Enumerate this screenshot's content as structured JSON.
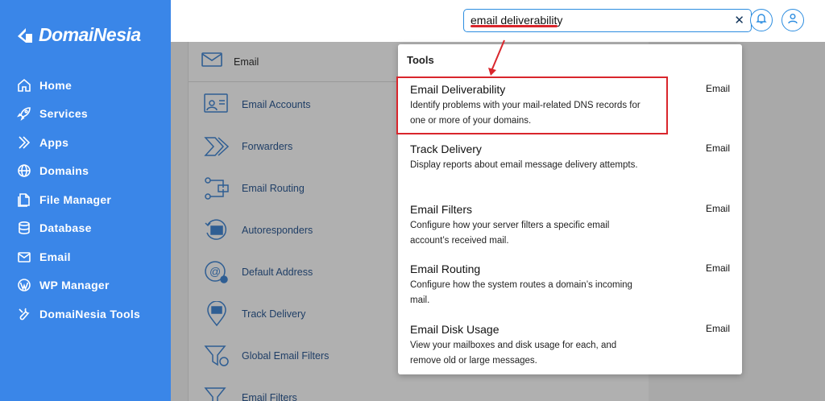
{
  "brand": {
    "name": "DomaiNesia"
  },
  "sidebar": {
    "items": [
      {
        "label": "Home",
        "icon": "home-icon"
      },
      {
        "label": "Services",
        "icon": "rocket-icon"
      },
      {
        "label": "Apps",
        "icon": "apps-icon"
      },
      {
        "label": "Domains",
        "icon": "globe-icon"
      },
      {
        "label": "File Manager",
        "icon": "file-icon"
      },
      {
        "label": "Database",
        "icon": "database-icon"
      },
      {
        "label": "Email",
        "icon": "mail-icon"
      },
      {
        "label": "WP Manager",
        "icon": "wordpress-icon"
      },
      {
        "label": "DomaiNesia Tools",
        "icon": "tools-icon"
      }
    ]
  },
  "search": {
    "value": "email deliverability"
  },
  "email_section": {
    "header": "Email",
    "tools": [
      "Email Accounts",
      "Forwarders",
      "Email Routing",
      "Autoresponders",
      "Default Address",
      "Track Delivery",
      "Global Email Filters",
      "Email Filters"
    ]
  },
  "dropdown": {
    "title": "Tools",
    "results": [
      {
        "title": "Email Deliverability",
        "desc": "Identify problems with your mail-related DNS records for one or more of your domains.",
        "category": "Email"
      },
      {
        "title": "Track Delivery",
        "desc": "Display reports about email message delivery attempts.",
        "category": "Email"
      },
      {
        "title": "Email Filters",
        "desc": "Configure how your server filters a specific email account’s received mail.",
        "category": "Email"
      },
      {
        "title": "Email Routing",
        "desc": "Configure how the system routes a domain’s incoming mail.",
        "category": "Email"
      },
      {
        "title": "Email Disk Usage",
        "desc": "View your mailboxes and disk usage for each, and remove old or large messages.",
        "category": "Email"
      }
    ]
  },
  "colors": {
    "sidebar": "#3a86e8",
    "accent": "#2c8de0",
    "annotation": "#d9262c"
  }
}
